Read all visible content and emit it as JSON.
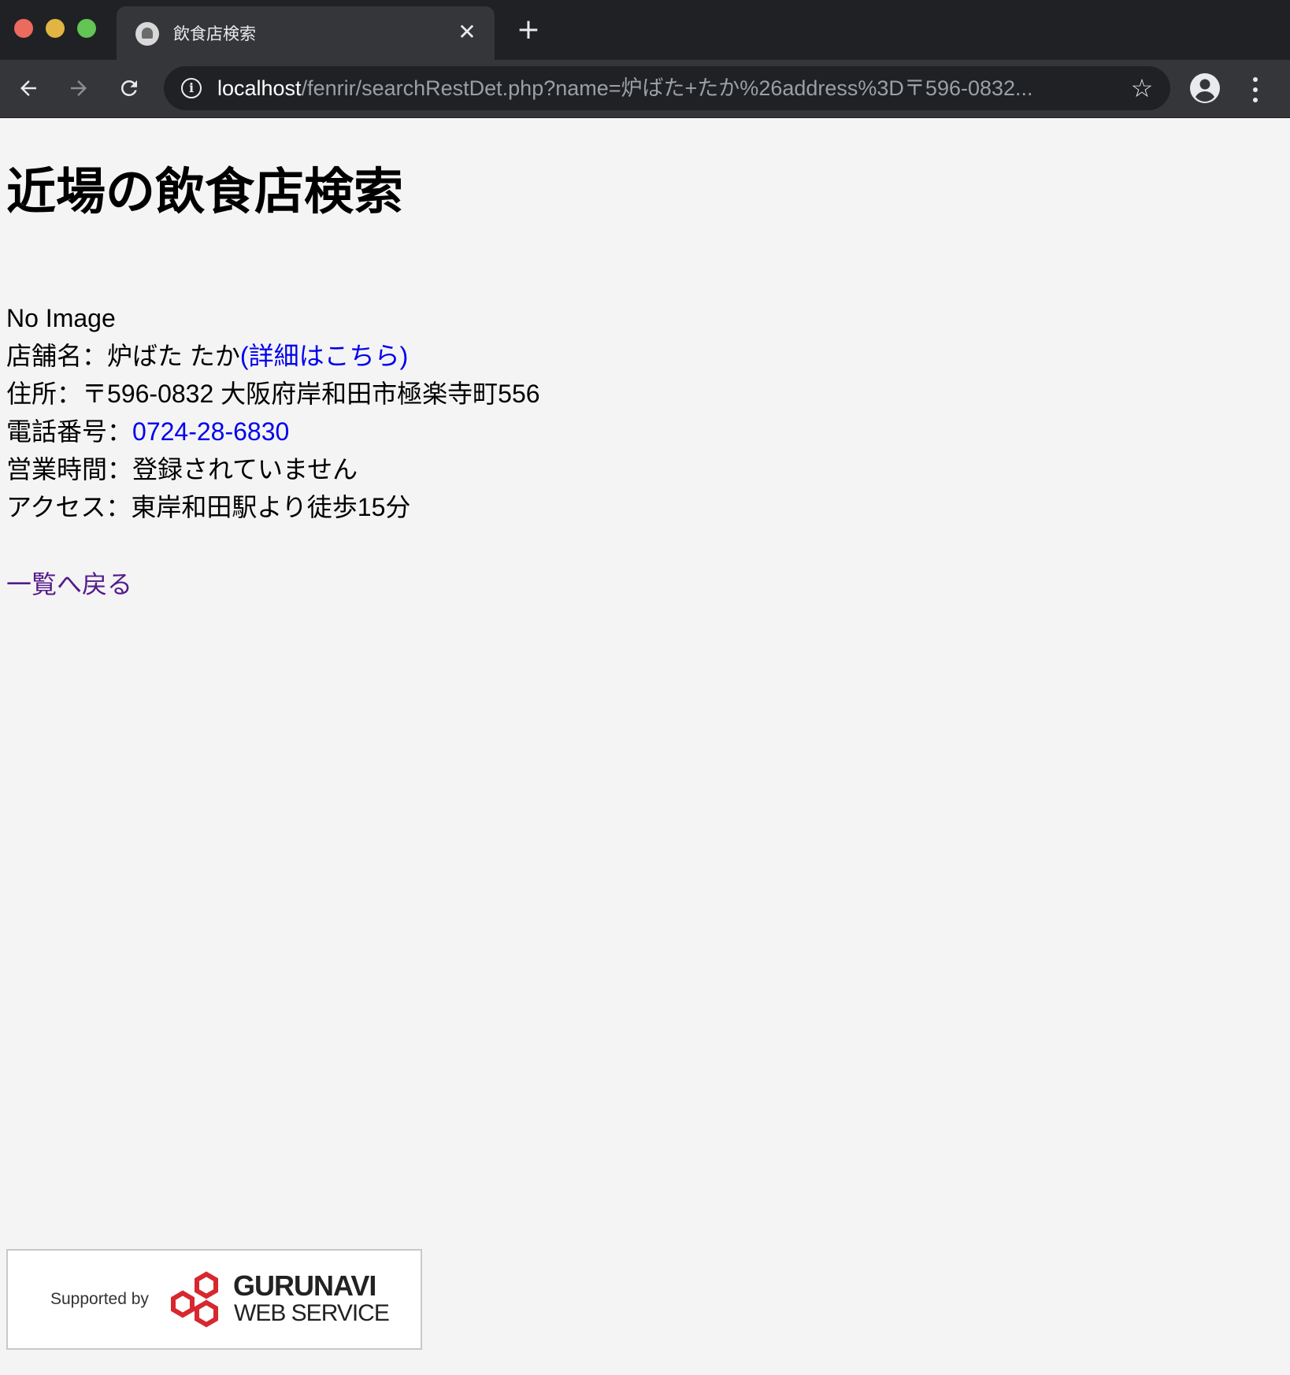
{
  "browser": {
    "tab_title": "飲食店検索",
    "url_host": "localhost",
    "url_path": "/fenrir/searchRestDet.php?name=炉ばた+たか%26address%3D〒596-0832..."
  },
  "page": {
    "heading": "近場の飲食店検索",
    "image_text": "No Image",
    "store_label": "店舗名：",
    "store_name": "炉ばた たか",
    "store_link": "(詳細はこちら)",
    "address_label": "住所：",
    "address": "〒596-0832 大阪府岸和田市極楽寺町556",
    "phone_label": "電話番号：",
    "phone": "0724-28-6830",
    "hours_label": "営業時間：",
    "hours": "登録されていません",
    "access_label": "アクセス：",
    "access": "東岸和田駅より徒歩15分",
    "back_link": "一覧へ戻る"
  },
  "credit": {
    "supported_by": "Supported by",
    "brand": "GURUNAVI",
    "sub": "WEB SERVICE"
  },
  "colors": {
    "link": "#0000ee",
    "visited_link": "#551a8b",
    "chrome_bg": "#202124",
    "page_bg": "#f4f4f4",
    "logo_red": "#d7282f"
  }
}
